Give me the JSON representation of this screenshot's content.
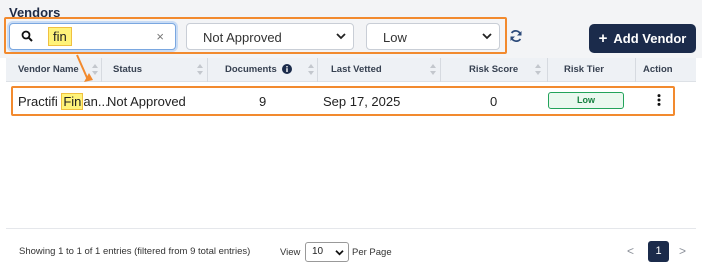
{
  "page": {
    "title": "Vendors"
  },
  "filters": {
    "search_value": "fin",
    "clear_symbol": "×",
    "status_value": "Not Approved",
    "tier_value": "Low"
  },
  "toolbar": {
    "add_label": "Add Vendor",
    "add_symbol": "+"
  },
  "table": {
    "columns": [
      "Vendor Name",
      "Status",
      "Documents",
      "Last Vetted",
      "Risk Score",
      "Risk Tier",
      "Action"
    ],
    "rows": [
      {
        "vendor_name_pre": "Practifi ",
        "vendor_name_match": "Fin",
        "vendor_name_post": "an...",
        "status": "Not Approved",
        "documents": "9",
        "last_vetted": "Sep 17, 2025",
        "risk_score": "0",
        "risk_tier": "Low"
      }
    ]
  },
  "footer": {
    "entries_text": "Showing 1 to 1 of 1 entries (filtered from 9 total entries)",
    "view_label": "View",
    "per_page_value": "10",
    "per_page_label": "Per Page",
    "prev_symbol": "<",
    "current_page": "1",
    "next_symbol": ">"
  },
  "colors": {
    "accent_navy": "#1b2b4b",
    "annotation_orange": "#f28a2e",
    "highlight_yellow": "#fff37a",
    "tier_low_green": "#16803f"
  }
}
